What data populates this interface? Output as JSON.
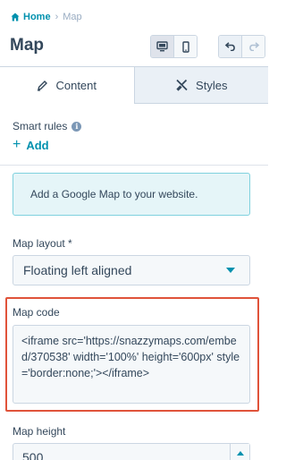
{
  "breadcrumb": {
    "home": "Home",
    "separator": "›",
    "current": "Map"
  },
  "title": "Map",
  "device_toggle": {
    "selected": "desktop",
    "options": [
      "desktop-icon",
      "mobile-icon"
    ]
  },
  "history": {
    "icons": [
      "undo-icon",
      "redo-icon"
    ]
  },
  "tabs": [
    {
      "label": "Content",
      "icon": "pencil-icon",
      "active": true
    },
    {
      "label": "Styles",
      "icon": "brush-icon",
      "active": false
    }
  ],
  "smart_rules": {
    "label": "Smart rules",
    "add_label": "Add"
  },
  "callout": {
    "text": "Add a Google Map to your website."
  },
  "map_layout": {
    "label": "Map layout *",
    "value": "Floating left aligned"
  },
  "map_code": {
    "label": "Map code",
    "value": "<iframe src='https://snazzymaps.com/embed/370538' width='100%' height='600px' style='border:none;'></iframe>"
  },
  "map_height": {
    "label": "Map height",
    "value": "500"
  },
  "colors": {
    "accent": "#0091ae",
    "text": "#33475b",
    "highlight": "#e0533a",
    "callout_bg": "#e5f5f8"
  }
}
